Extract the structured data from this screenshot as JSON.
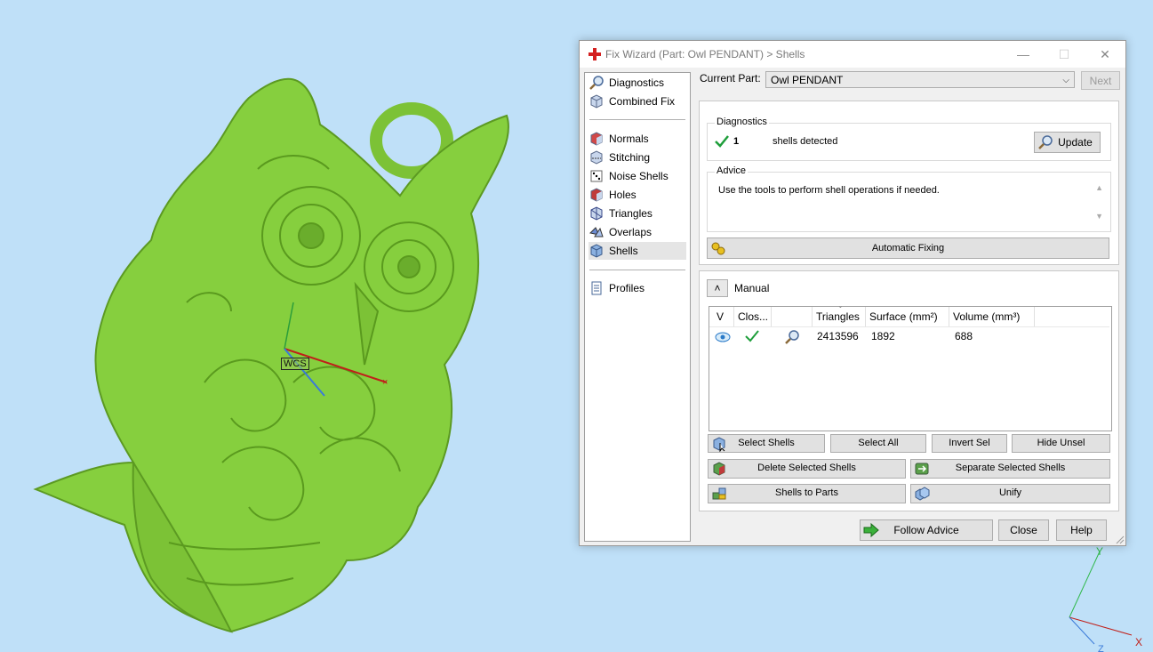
{
  "viewport": {
    "wcs_label": "WCS",
    "axis_labels": {
      "y": "Y",
      "x": "X",
      "z": "Z"
    }
  },
  "window": {
    "title": "Fix Wizard (Part: Owl  PENDANT) > Shells",
    "controls": {
      "minimize": "—",
      "maximize": "☐",
      "close": "✕"
    }
  },
  "nav": {
    "top_items": [
      {
        "label": "Diagnostics",
        "icon": "magnifier-icon"
      },
      {
        "label": "Combined Fix",
        "icon": "cube-icon"
      }
    ],
    "fix_items": [
      {
        "label": "Normals",
        "icon": "normals-cube-icon"
      },
      {
        "label": "Stitching",
        "icon": "stitching-cube-icon"
      },
      {
        "label": "Noise Shells",
        "icon": "dice-icon"
      },
      {
        "label": "Holes",
        "icon": "holes-cube-icon"
      },
      {
        "label": "Triangles",
        "icon": "triangles-icon"
      },
      {
        "label": "Overlaps",
        "icon": "overlaps-icon"
      },
      {
        "label": "Shells",
        "icon": "shells-cube-icon",
        "selected": true
      }
    ],
    "bottom_items": [
      {
        "label": "Profiles",
        "icon": "document-icon"
      }
    ]
  },
  "header": {
    "current_part_label": "Current Part:",
    "current_part_value": "Owl  PENDANT",
    "next_label": "Next"
  },
  "diagnostics": {
    "title": "Diagnostics",
    "count": "1",
    "text": "shells detected",
    "update_label": "Update"
  },
  "advice": {
    "title": "Advice",
    "text": "Use the tools to perform shell operations if needed."
  },
  "automatic_fixing_label": "Automatic Fixing",
  "manual": {
    "title": "Manual",
    "columns": [
      "V",
      "Clos...",
      "",
      "Triangles",
      "Surface (mm²)",
      "Volume (mm³)"
    ],
    "rows": [
      {
        "triangles": "2413596",
        "surface": "1892",
        "volume": "688"
      }
    ],
    "buttons": {
      "select_shells": "Select Shells",
      "select_all": "Select All",
      "invert_sel": "Invert Sel",
      "hide_unsel": "Hide Unsel",
      "delete_selected": "Delete Selected Shells",
      "separate_selected": "Separate Selected Shells",
      "shells_to_parts": "Shells to Parts",
      "unify": "Unify"
    }
  },
  "footer": {
    "follow_advice": "Follow Advice",
    "close": "Close",
    "help": "Help"
  },
  "colors": {
    "background": "#bfe0f8",
    "model": "#86cf3e",
    "check": "#1e9e3a",
    "accent_red": "#d42020"
  }
}
